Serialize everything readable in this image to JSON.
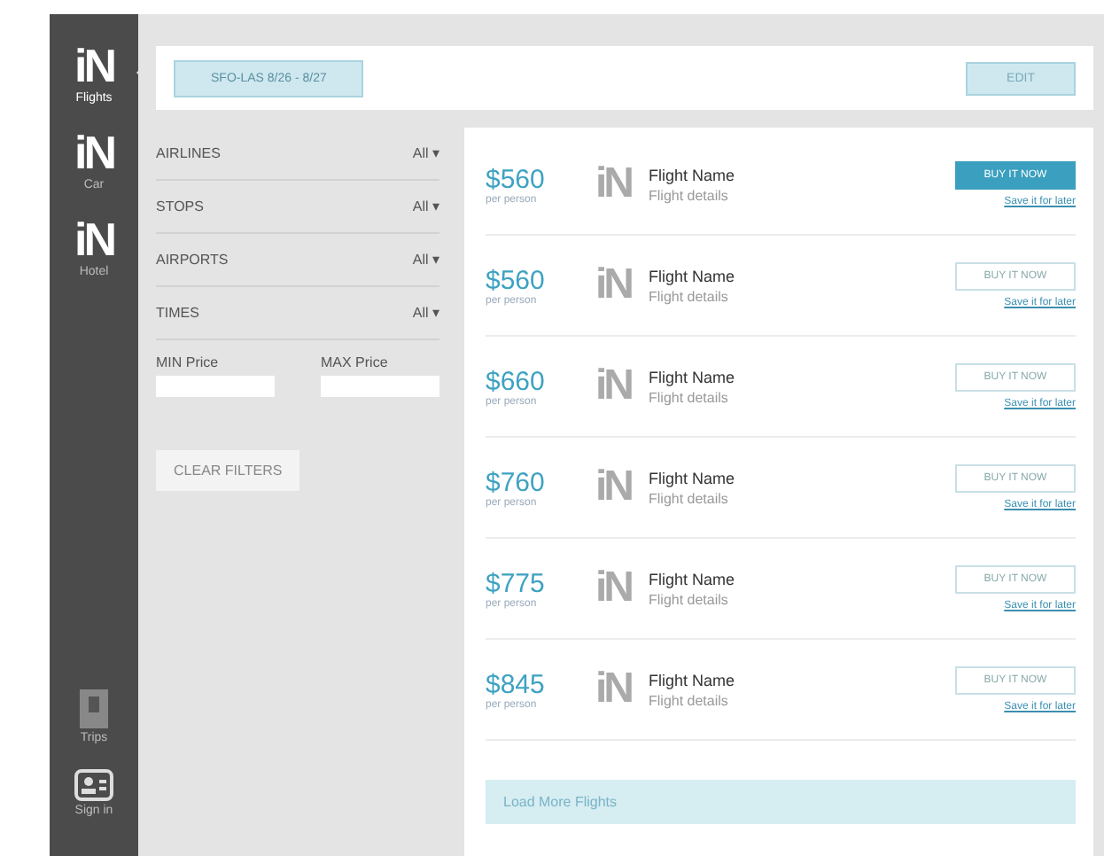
{
  "sidebar": {
    "items": [
      {
        "logo": "iN",
        "label": "Flights",
        "selected": true,
        "kind": "logo"
      },
      {
        "logo": "iN",
        "label": "Car",
        "selected": false,
        "kind": "logo"
      },
      {
        "logo": "iN",
        "label": "Hotel",
        "selected": false,
        "kind": "logo"
      },
      {
        "label": "Trips",
        "selected": false,
        "kind": "trips"
      },
      {
        "label": "Sign in",
        "selected": false,
        "kind": "signin"
      }
    ]
  },
  "search_bar": {
    "query": "SFO-LAS 8/26 - 8/27",
    "edit_button": "EDIT"
  },
  "filters": {
    "items": [
      {
        "label": "AIRLINES",
        "value": "All",
        "caret": "▾"
      },
      {
        "label": "STOPS",
        "value": "All",
        "caret": "▾"
      },
      {
        "label": "AIRPORTS",
        "value": "All",
        "caret": "▾"
      },
      {
        "label": "TIMES",
        "value": "All",
        "caret": "▾"
      }
    ],
    "min_label": "MIN Price",
    "max_label": "MAX Price",
    "clear_button": "CLEAR FILTERS"
  },
  "results": [
    {
      "price": "$560",
      "note": "per person",
      "logo": "iN",
      "name": "Flight Name",
      "details": "Flight details",
      "button": "BUY IT NOW",
      "link": "Save it for later",
      "selected": true
    },
    {
      "price": "$560",
      "note": "per person",
      "logo": "iN",
      "name": "Flight Name",
      "details": "Flight details",
      "button": "BUY IT NOW",
      "link": "Save it for later",
      "selected": false
    },
    {
      "price": "$660",
      "note": "per person",
      "logo": "iN",
      "name": "Flight Name",
      "details": "Flight details",
      "button": "BUY IT NOW",
      "link": "Save it for later",
      "selected": false
    },
    {
      "price": "$760",
      "note": "per person",
      "logo": "iN",
      "name": "Flight Name",
      "details": "Flight details",
      "button": "BUY IT NOW",
      "link": "Save it for later",
      "selected": false
    },
    {
      "price": "$775",
      "note": "per person",
      "logo": "iN",
      "name": "Flight Name",
      "details": "Flight details",
      "button": "BUY IT NOW",
      "link": "Save it for later",
      "selected": false
    },
    {
      "price": "$845",
      "note": "per person",
      "logo": "iN",
      "name": "Flight Name",
      "details": "Flight details",
      "button": "BUY IT NOW",
      "link": "Save it for later",
      "selected": false
    }
  ],
  "load_more": "Load More Flights"
}
